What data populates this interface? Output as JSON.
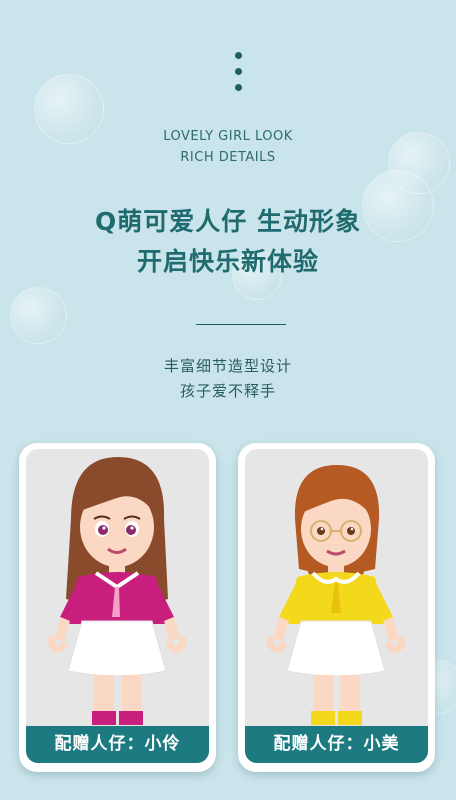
{
  "header": {
    "english_line1": "LOVELY GIRL LOOK",
    "english_line2": "RICH DETAILS",
    "headline_line1": "Q萌可爱人仔  生动形象",
    "headline_line2": "开启快乐新体验",
    "sub_line1": "丰富细节造型设计",
    "sub_line2": "孩子爱不释手"
  },
  "cards": [
    {
      "label": "配赠人仔：小伶",
      "shirt_color": "#c81e7e",
      "hair_color": "#8a4a2c"
    },
    {
      "label": "配赠人仔：小美",
      "shirt_color": "#f4d81c",
      "hair_color": "#b45a22"
    }
  ],
  "colors": {
    "background": "#c9e4ea",
    "accent": "#1c7a80"
  }
}
